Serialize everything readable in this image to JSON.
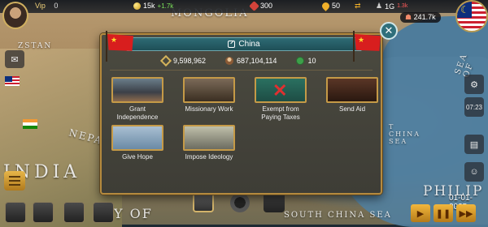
{
  "top_bar": {
    "vip_label": "Vip",
    "vip_value": "0",
    "gold": "15k",
    "gold_income": "+1.7k",
    "gems": "300",
    "oil": "50",
    "mil_value": "1G",
    "mil_sub": "1.3k",
    "population": "241.7k"
  },
  "map": {
    "labels": [
      "MONGOLIA",
      "INDIA",
      "NEPAL",
      "SOUTH CHINA SEA",
      "PHILIP",
      "SEA OF",
      "T CHINA SEA",
      "Y OF",
      "ZSTAN"
    ]
  },
  "right_panel": {
    "clock": "07:23",
    "date": "01-01-2025"
  },
  "dialog": {
    "title": "China",
    "area": "9,598,962",
    "population": "687,104,114",
    "cash": "10",
    "actions": [
      {
        "label": "Grant Independence",
        "icon": "city-icon"
      },
      {
        "label": "Missionary Work",
        "icon": "book-icon"
      },
      {
        "label": "Exempt from Paying Taxes",
        "icon": "tax-exempt-icon"
      },
      {
        "label": "Send Aid",
        "icon": "gift-icon"
      },
      {
        "label": "Give Hope",
        "icon": "dove-icon"
      },
      {
        "label": "Impose Ideology",
        "icon": "monument-icon"
      }
    ]
  },
  "colors": {
    "dialog_header": "#2e6b74",
    "dialog_border": "#b58a3e",
    "china_flag": "#d81e1e"
  }
}
